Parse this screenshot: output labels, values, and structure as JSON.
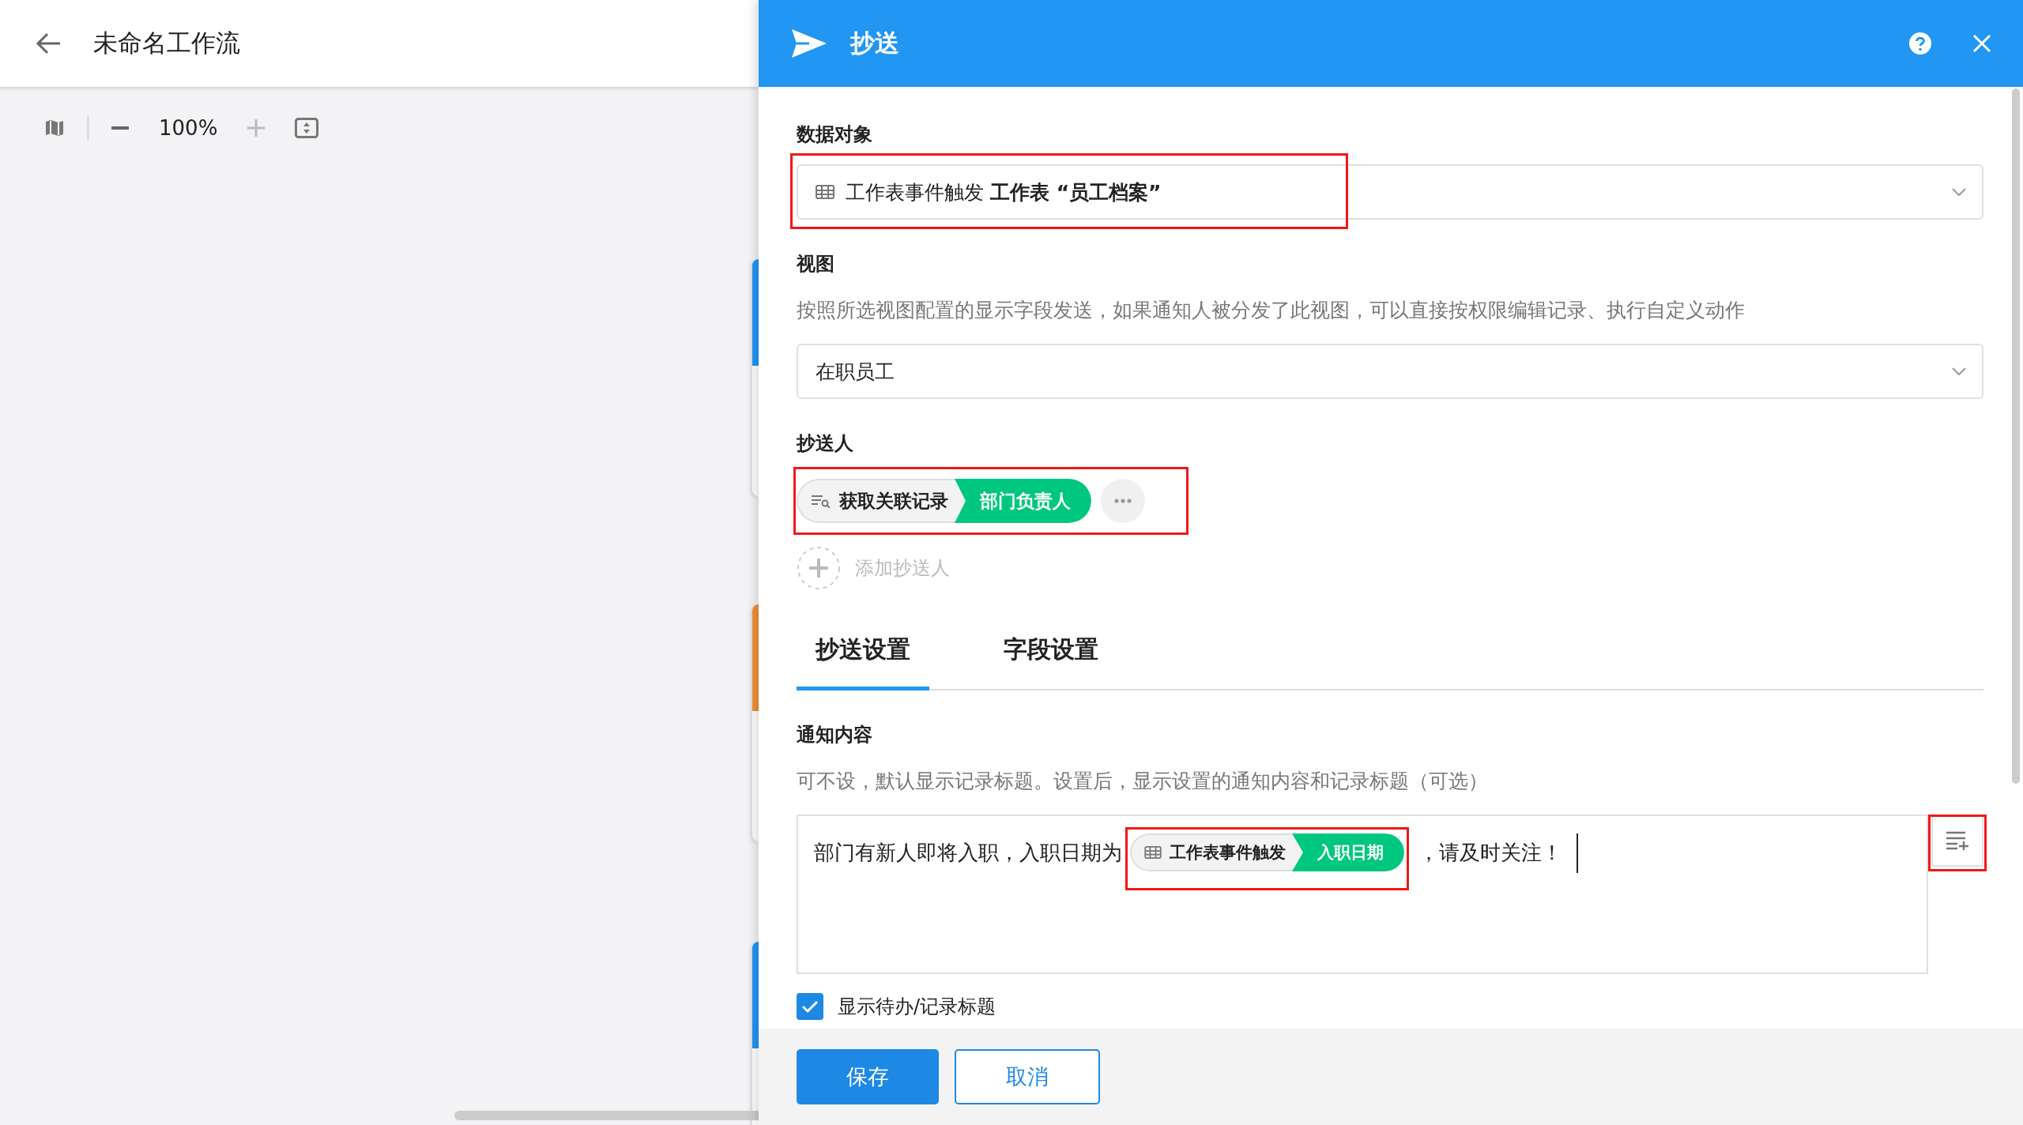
{
  "header": {
    "title": "未命名工作流"
  },
  "toolbar": {
    "zoom": "100%",
    "zoom_in_disabled": true
  },
  "nodes": [
    {
      "color": "#2196f3"
    },
    {
      "color": "#f0903a"
    },
    {
      "color": "#2196f3"
    }
  ],
  "panel": {
    "title": "抄送",
    "data_object": {
      "label": "数据对象",
      "source": "工作表事件触发",
      "value": "工作表 “员工档案”",
      "highlighted": true
    },
    "view": {
      "label": "视图",
      "hint": "按照所选视图配置的显示字段发送，如果通知人被分发了此视图，可以直接按权限编辑记录、执行自定义动作",
      "value": "在职员工"
    },
    "cc": {
      "label": "抄送人",
      "recipients": [
        {
          "source": "获取关联记录",
          "field": "部门负责人"
        }
      ],
      "highlighted": true,
      "add_label": "添加抄送人"
    },
    "tabs": [
      {
        "label": "抄送设置",
        "selected": true
      },
      {
        "label": "字段设置",
        "selected": false
      }
    ],
    "notice": {
      "label": "通知内容",
      "hint": "可不设，默认显示记录标题。设置后，显示设置的通知内容和记录标题（可选）",
      "before": "部门有新人即将入职，入职日期为",
      "token": {
        "source": "工作表事件触发",
        "field": "入职日期"
      },
      "after": "，请及时关注！",
      "highlighted": true,
      "insert_highlighted": true
    },
    "show_title": {
      "label": "显示待办/记录标题",
      "checked": true
    },
    "buttons": [
      {
        "label": "保存",
        "kind": "primary"
      },
      {
        "label": "取消",
        "kind": "secondary"
      }
    ]
  }
}
